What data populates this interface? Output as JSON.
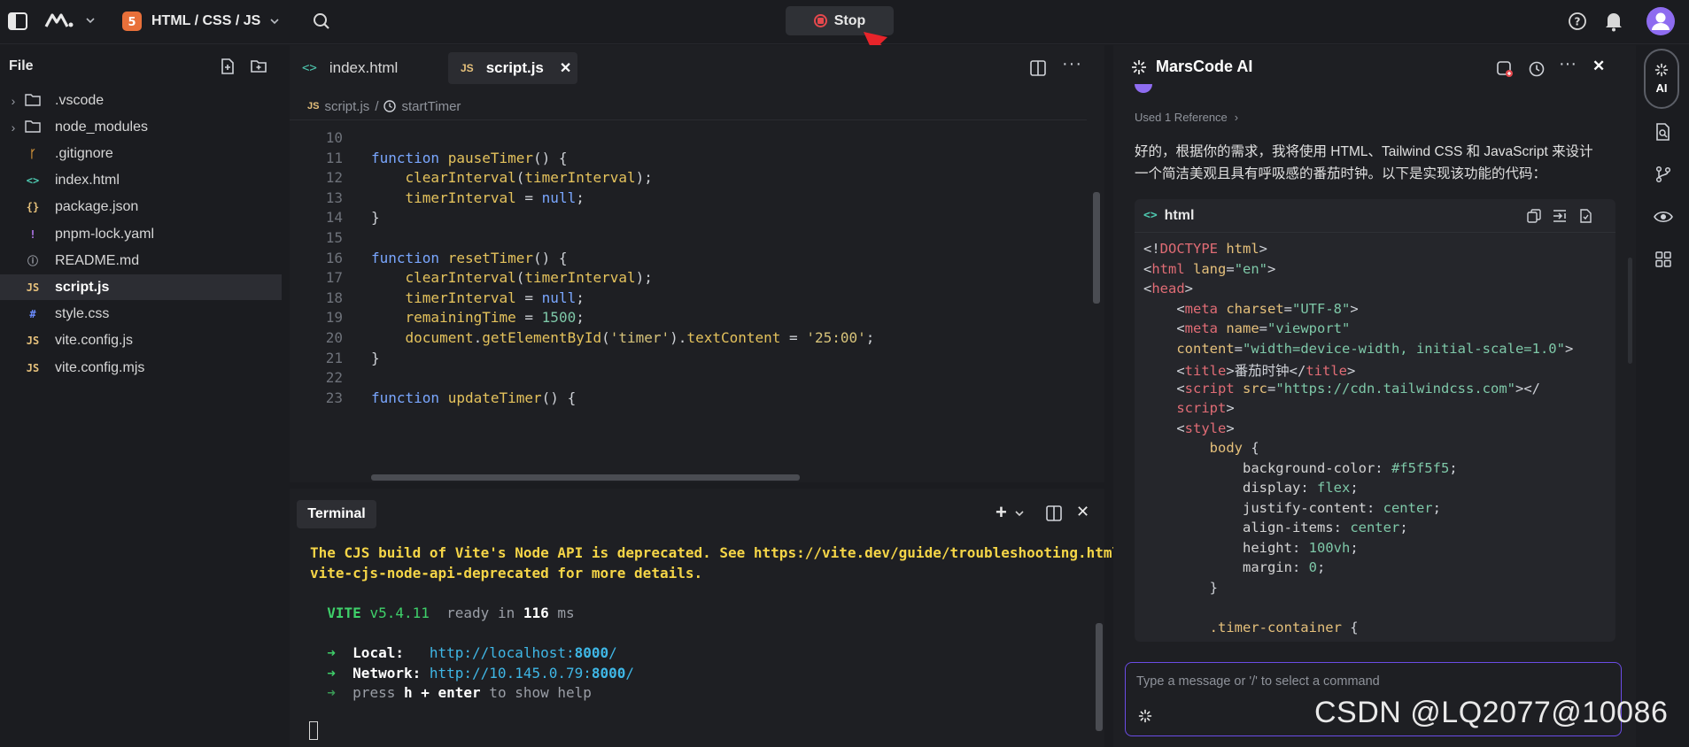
{
  "topbar": {
    "project": "HTML / CSS / JS",
    "stop_label": "Stop"
  },
  "sidebar": {
    "title": "File",
    "items": [
      {
        "icon": "folder",
        "label": ".vscode",
        "chevron": true
      },
      {
        "icon": "folder",
        "label": "node_modules",
        "chevron": true
      },
      {
        "icon": "git",
        "label": ".gitignore"
      },
      {
        "icon": "code",
        "label": "index.html"
      },
      {
        "icon": "braces",
        "label": "package.json"
      },
      {
        "icon": "exclaim",
        "label": "pnpm-lock.yaml"
      },
      {
        "icon": "info",
        "label": "README.md"
      },
      {
        "icon": "js",
        "label": "script.js",
        "selected": true
      },
      {
        "icon": "hash",
        "label": "style.css"
      },
      {
        "icon": "js",
        "label": "vite.config.js"
      },
      {
        "icon": "js",
        "label": "vite.config.mjs"
      }
    ]
  },
  "editor": {
    "tabs": [
      {
        "label": "index.html",
        "icon": "<>"
      },
      {
        "label": "script.js",
        "icon": "JS",
        "active": true
      }
    ],
    "breadcrumb": {
      "file": "script.js",
      "symbol": "startTimer"
    },
    "lines": [
      {
        "n": "10",
        "segs": []
      },
      {
        "n": "11",
        "segs": [
          [
            "kw",
            "function "
          ],
          [
            "fn",
            "pauseTimer"
          ],
          [
            "id",
            "() {"
          ]
        ]
      },
      {
        "n": "12",
        "segs": [
          [
            "id",
            "    "
          ],
          [
            "fn",
            "clearInterval"
          ],
          [
            "id",
            "("
          ],
          [
            "fn",
            "timerInterval"
          ],
          [
            "id",
            ");"
          ]
        ]
      },
      {
        "n": "13",
        "segs": [
          [
            "id",
            "    "
          ],
          [
            "fn",
            "timerInterval"
          ],
          [
            "id",
            " = "
          ],
          [
            "kw",
            "null"
          ],
          [
            "id",
            ";"
          ]
        ]
      },
      {
        "n": "14",
        "segs": [
          [
            "id",
            "}"
          ]
        ]
      },
      {
        "n": "15",
        "segs": []
      },
      {
        "n": "16",
        "segs": [
          [
            "kw",
            "function "
          ],
          [
            "fn",
            "resetTimer"
          ],
          [
            "id",
            "() {"
          ]
        ]
      },
      {
        "n": "17",
        "segs": [
          [
            "id",
            "    "
          ],
          [
            "fn",
            "clearInterval"
          ],
          [
            "id",
            "("
          ],
          [
            "fn",
            "timerInterval"
          ],
          [
            "id",
            ");"
          ]
        ]
      },
      {
        "n": "18",
        "segs": [
          [
            "id",
            "    "
          ],
          [
            "fn",
            "timerInterval"
          ],
          [
            "id",
            " = "
          ],
          [
            "kw",
            "null"
          ],
          [
            "id",
            ";"
          ]
        ]
      },
      {
        "n": "19",
        "segs": [
          [
            "id",
            "    "
          ],
          [
            "fn",
            "remainingTime"
          ],
          [
            "id",
            " = "
          ],
          [
            "num",
            "1500"
          ],
          [
            "id",
            ";"
          ]
        ]
      },
      {
        "n": "20",
        "segs": [
          [
            "id",
            "    "
          ],
          [
            "fn",
            "document"
          ],
          [
            "id",
            "."
          ],
          [
            "fn",
            "getElementById"
          ],
          [
            "id",
            "("
          ],
          [
            "str",
            "'timer'"
          ],
          [
            "id",
            ")."
          ],
          [
            "fn",
            "textContent"
          ],
          [
            "id",
            " = "
          ],
          [
            "str",
            "'25:00'"
          ],
          [
            "id",
            ";"
          ]
        ]
      },
      {
        "n": "21",
        "segs": [
          [
            "id",
            "}"
          ]
        ]
      },
      {
        "n": "22",
        "segs": []
      },
      {
        "n": "23",
        "segs": [
          [
            "kw",
            "function "
          ],
          [
            "fn",
            "updateTimer"
          ],
          [
            "id",
            "() {"
          ]
        ]
      }
    ]
  },
  "terminal": {
    "tab_label": "Terminal",
    "lines": [
      {
        "segs": [
          [
            "y",
            "The CJS build of Vite's Node API is deprecated. See https://vite.dev/guide/troubleshooting.html#"
          ]
        ]
      },
      {
        "segs": [
          [
            "y",
            "vite-cjs-node-api-deprecated for more details."
          ]
        ]
      },
      {
        "segs": []
      },
      {
        "segs": [
          [
            "g",
            "  VITE "
          ],
          [
            "g",
            "v5.4.11"
          ],
          [
            "d",
            "  ready in "
          ],
          [
            "w",
            "116"
          ],
          [
            "d",
            " ms"
          ]
        ]
      },
      {
        "segs": []
      },
      {
        "segs": [
          [
            "g",
            "  ➜  "
          ],
          [
            "w",
            "Local:"
          ],
          [
            "c",
            "   http://localhost:"
          ],
          [
            "cb",
            "8000"
          ],
          [
            "c",
            "/"
          ]
        ]
      },
      {
        "segs": [
          [
            "g",
            "  ➜  "
          ],
          [
            "w",
            "Network:"
          ],
          [
            "c",
            " http://10.145.0.79:"
          ],
          [
            "cb",
            "8000"
          ],
          [
            "c",
            "/"
          ]
        ]
      },
      {
        "segs": [
          [
            "dg",
            "  ➜  "
          ],
          [
            "d",
            "press "
          ],
          [
            "w",
            "h + enter"
          ],
          [
            "d",
            " to show help"
          ]
        ]
      }
    ]
  },
  "ai": {
    "title": "MarsCode AI",
    "reference": "Used 1 Reference",
    "intro_1": "好的，根据你的需求，我将使用 HTML、Tailwind CSS 和 JavaScript 来设计",
    "intro_2": "一个简洁美观且具有呼吸感的番茄时钟。以下是实现该功能的代码：",
    "code_lang": "html",
    "code_lines": [
      [
        [
          "pun",
          "<!"
        ],
        [
          "tagc",
          "DOCTYPE"
        ],
        [
          "pun",
          " "
        ],
        [
          "attr",
          "html"
        ],
        [
          "pun",
          ">"
        ]
      ],
      [
        [
          "pun",
          "<"
        ],
        [
          "tagc",
          "html"
        ],
        [
          "pun",
          " "
        ],
        [
          "attr",
          "lang"
        ],
        [
          "pun",
          "="
        ],
        [
          "val",
          "\"en\""
        ],
        [
          "pun",
          ">"
        ]
      ],
      [
        [
          "pun",
          "<"
        ],
        [
          "tagc",
          "head"
        ],
        [
          "pun",
          ">"
        ]
      ],
      [
        [
          "pun",
          "    <"
        ],
        [
          "tagc",
          "meta"
        ],
        [
          "pun",
          " "
        ],
        [
          "attr",
          "charset"
        ],
        [
          "pun",
          "="
        ],
        [
          "val",
          "\"UTF-8\""
        ],
        [
          "pun",
          ">"
        ]
      ],
      [
        [
          "pun",
          "    <"
        ],
        [
          "tagc",
          "meta"
        ],
        [
          "pun",
          " "
        ],
        [
          "attr",
          "name"
        ],
        [
          "pun",
          "="
        ],
        [
          "val",
          "\"viewport\""
        ]
      ],
      [
        [
          "attr",
          "    content"
        ],
        [
          "pun",
          "="
        ],
        [
          "val",
          "\"width=device-width, initial-scale=1.0\""
        ],
        [
          "pun",
          ">"
        ]
      ],
      [
        [
          "pun",
          "    <"
        ],
        [
          "tagc",
          "title"
        ],
        [
          "pun",
          ">番茄时钟</"
        ],
        [
          "tagc",
          "title"
        ],
        [
          "pun",
          ">"
        ]
      ],
      [
        [
          "pun",
          "    <"
        ],
        [
          "tagc",
          "script"
        ],
        [
          "pun",
          " "
        ],
        [
          "attr",
          "src"
        ],
        [
          "pun",
          "="
        ],
        [
          "val",
          "\"https://cdn.tailwindcss.com\""
        ],
        [
          "pun",
          "></"
        ]
      ],
      [
        [
          "tagc",
          "    script"
        ],
        [
          "pun",
          ">"
        ]
      ],
      [
        [
          "pun",
          "    <"
        ],
        [
          "tagc",
          "style"
        ],
        [
          "pun",
          ">"
        ]
      ],
      [
        [
          "attr",
          "        body"
        ],
        [
          "pun",
          " {"
        ]
      ],
      [
        [
          "prop",
          "            background-color"
        ],
        [
          "pun",
          ": "
        ],
        [
          "val",
          "#f5f5f5"
        ],
        [
          "pun",
          ";"
        ]
      ],
      [
        [
          "prop",
          "            display"
        ],
        [
          "pun",
          ": "
        ],
        [
          "val",
          "flex"
        ],
        [
          "pun",
          ";"
        ]
      ],
      [
        [
          "prop",
          "            justify-content"
        ],
        [
          "pun",
          ": "
        ],
        [
          "val",
          "center"
        ],
        [
          "pun",
          ";"
        ]
      ],
      [
        [
          "prop",
          "            align-items"
        ],
        [
          "pun",
          ": "
        ],
        [
          "val",
          "center"
        ],
        [
          "pun",
          ";"
        ]
      ],
      [
        [
          "prop",
          "            height"
        ],
        [
          "pun",
          ": "
        ],
        [
          "val",
          "100vh"
        ],
        [
          "pun",
          ";"
        ]
      ],
      [
        [
          "prop",
          "            margin"
        ],
        [
          "pun",
          ": "
        ],
        [
          "val",
          "0"
        ],
        [
          "pun",
          ";"
        ]
      ],
      [
        [
          "pun",
          "        }"
        ]
      ],
      [],
      [
        [
          "attr",
          "        .timer-container"
        ],
        [
          "pun",
          " {"
        ]
      ]
    ],
    "input_placeholder": "Type a message or '/' to select a command"
  },
  "rail": {
    "ai_label": "AI"
  },
  "watermark": "CSDN @LQ2077@10086"
}
